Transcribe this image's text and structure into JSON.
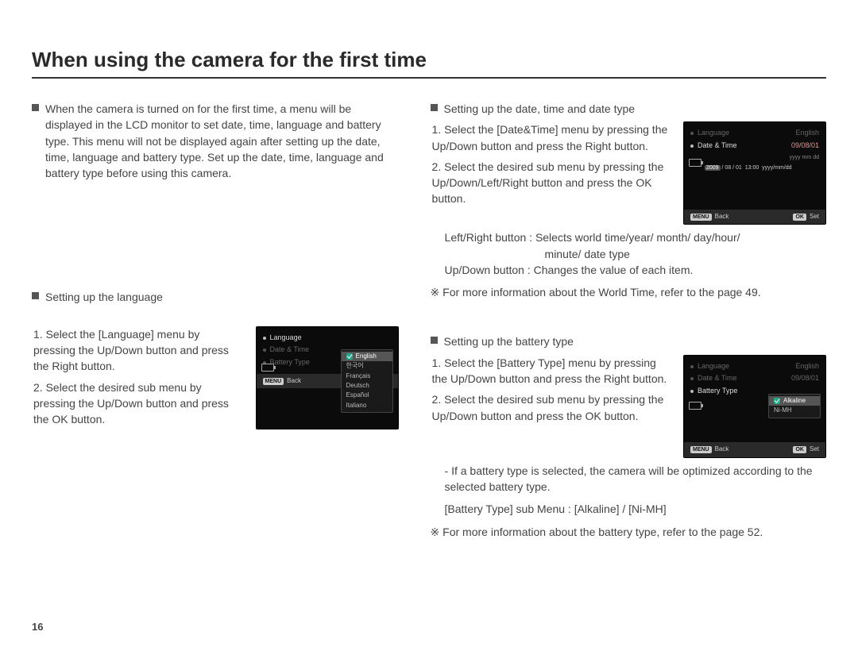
{
  "title": "When using the camera for the first time",
  "page_number": "16",
  "intro": "When the camera is turned on for the first time, a menu will be displayed in the LCD monitor to set date, time, language and battery type. This menu will not be displayed again after setting up the date, time, language and battery type. Set up the date, time, language and battery type before using this camera.",
  "lang": {
    "heading": "Setting up the language",
    "step1": "1. Select the [Language] menu by pressing the Up/Down button and press the Right button.",
    "step2": "2. Select the desired sub menu by pressing the Up/Down button and press the OK button."
  },
  "date": {
    "heading": "Setting up the date, time and date type",
    "step1": "1. Select the [Date&Time] menu by pressing the Up/Down button and press the Right button.",
    "step2": "2. Select the desired sub menu by pressing the Up/Down/Left/Right button and press the OK button.",
    "lr": "Left/Right button : Selects world time/year/ month/ day/hour/",
    "lr2": "minute/ date type",
    "ud": "Up/Down button : Changes the value of each item.",
    "note": "※ For more information about the World Time, refer to the page 49."
  },
  "batt": {
    "heading": "Setting up the battery type",
    "step1": "1. Select the [Battery Type] menu by pressing the Up/Down button and press the Right button.",
    "step2": "2. Select the desired sub menu by pressing the Up/Down button and press the OK button.",
    "note1": "- If a battery type is selected, the camera will be optimized according to the selected battery type.",
    "note2": "[Battery Type] sub Menu : [Alkaline] / [Ni-MH]",
    "note3": "※ For more information about the battery type, refer to the page 52."
  },
  "lcd_common": {
    "back_btn": "MENU",
    "back": "Back",
    "set_btn": "OK",
    "set": "Set",
    "lang_label": "Language",
    "date_label": "Date & Time",
    "batt_label": "Battery Type",
    "lang_val": "English",
    "date_val": "09/08/01"
  },
  "lcd_lang": {
    "opts": [
      "English",
      "한국어",
      "Français",
      "Deutsch",
      "Español",
      "Italiano"
    ]
  },
  "lcd_date": {
    "hint": "yyyy mm dd",
    "row": [
      "2009",
      "/ 08 / 01",
      "13:00",
      "yyyy/mm/dd"
    ]
  },
  "lcd_batt": {
    "opts": [
      "Alkaline",
      "Ni-MH"
    ]
  }
}
